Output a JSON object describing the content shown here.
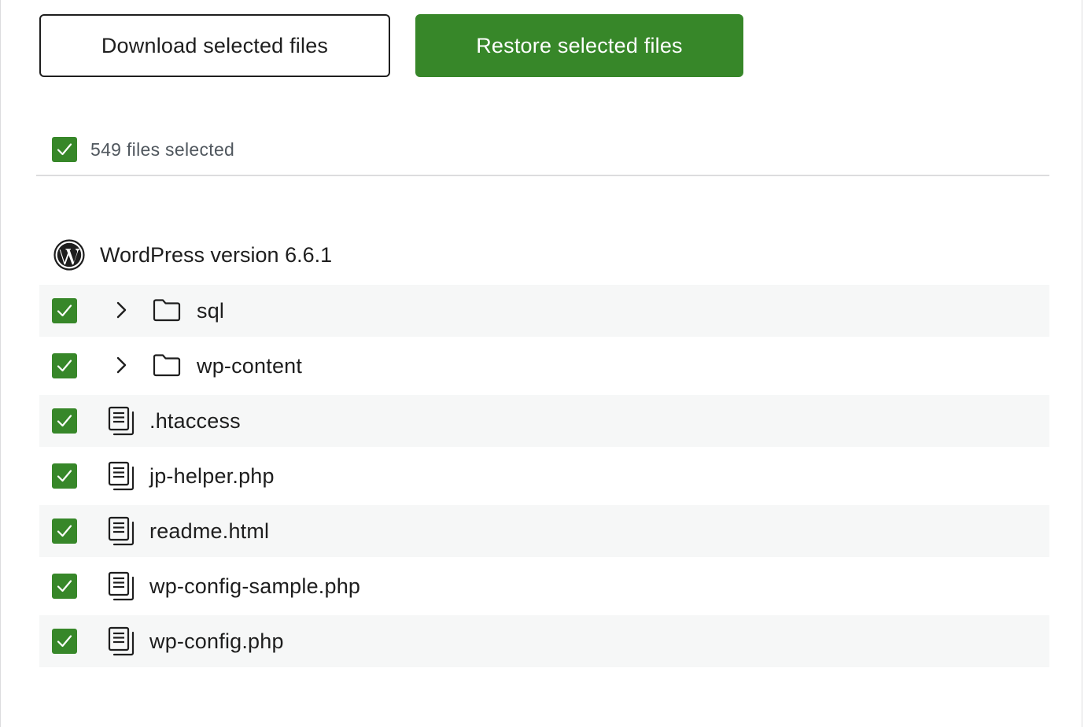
{
  "toolbar": {
    "download_label": "Download selected files",
    "restore_label": "Restore selected files"
  },
  "selection": {
    "summary": "549 files selected",
    "all_checked": true
  },
  "wordpress": {
    "title": "WordPress version 6.6.1",
    "icon": "wordpress-logo-icon"
  },
  "colors": {
    "accent": "#378729",
    "row_shade": "#f6f7f7",
    "text": "#1e1e1e",
    "muted": "#50575e",
    "divider": "#dcdcde"
  },
  "files": [
    {
      "name": "sql",
      "type": "folder",
      "checked": true,
      "icon": "folder-icon"
    },
    {
      "name": "wp-content",
      "type": "folder",
      "checked": true,
      "icon": "folder-icon"
    },
    {
      "name": ".htaccess",
      "type": "file",
      "checked": true,
      "icon": "file-icon"
    },
    {
      "name": "jp-helper.php",
      "type": "file",
      "checked": true,
      "icon": "file-icon"
    },
    {
      "name": "readme.html",
      "type": "file",
      "checked": true,
      "icon": "file-icon"
    },
    {
      "name": "wp-config-sample.php",
      "type": "file",
      "checked": true,
      "icon": "file-icon"
    },
    {
      "name": "wp-config.php",
      "type": "file",
      "checked": true,
      "icon": "file-icon"
    }
  ]
}
